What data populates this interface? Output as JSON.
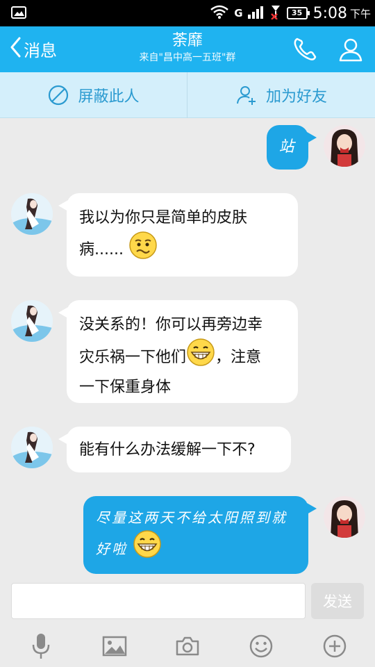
{
  "status_bar": {
    "carrier": "G",
    "battery": "35",
    "time": "5:08",
    "ampm": "下午"
  },
  "header": {
    "back_label": "消息",
    "title": "荼靡",
    "subtitle": "来自\"昌中高一五班\"群",
    "color": "#1fb3f0"
  },
  "actions": {
    "block_label": "屏蔽此人",
    "add_friend_label": "加为好友"
  },
  "messages": [
    {
      "direction": "out",
      "text": "站"
    },
    {
      "direction": "in",
      "lines": [
        "我以为你只是简单的皮肤",
        "病......"
      ],
      "emoji": "worried-face"
    },
    {
      "direction": "in",
      "lines": [
        "没关系的！你可以再旁边幸",
        "灾乐祸一下他们",
        "，注意",
        "一下保重身体"
      ],
      "emoji": "grin-face"
    },
    {
      "direction": "in",
      "lines": [
        "能有什么办法缓解一下不?"
      ]
    },
    {
      "direction": "out",
      "lines": [
        "尽量这两天不给太阳照到就",
        "好啦"
      ],
      "emoji": "grin-face"
    }
  ],
  "input": {
    "placeholder": "",
    "value": "",
    "send_label": "发送"
  },
  "toolbar": [
    "microphone-icon",
    "image-icon",
    "camera-icon",
    "emoji-icon",
    "plus-icon"
  ]
}
